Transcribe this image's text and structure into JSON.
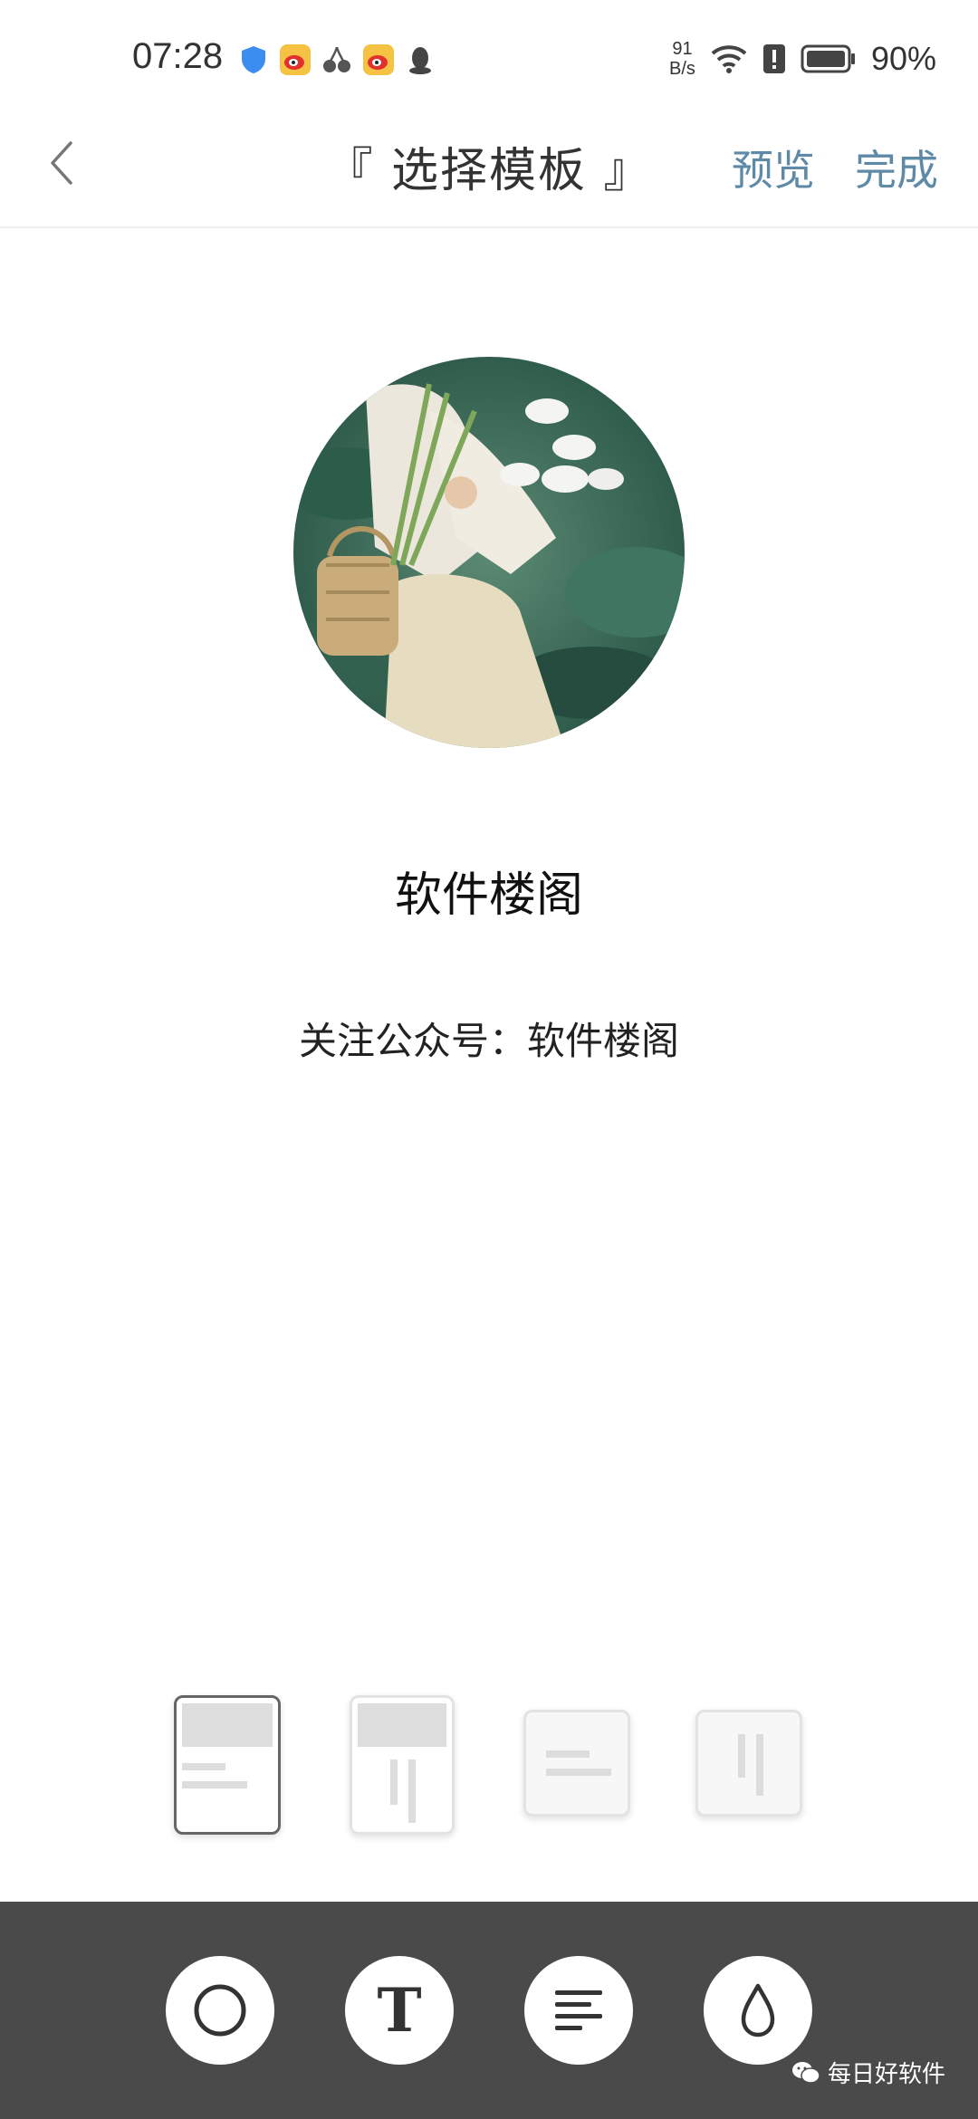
{
  "status_bar": {
    "time": "07:28",
    "net_speed_value": "91",
    "net_speed_unit": "B/s",
    "battery": "90%",
    "icons": [
      "shield-icon",
      "weibo-icon",
      "cherry-icon",
      "weibo-icon",
      "qq-icon",
      "wifi-icon",
      "alert-icon",
      "battery-icon"
    ]
  },
  "header": {
    "title": "『 选择模板 』",
    "preview_label": "预览",
    "done_label": "完成",
    "back_icon": "chevron-left-icon",
    "accent_color": "#5e8aa8"
  },
  "profile": {
    "name": "软件楼阁",
    "subtitle": "关注公众号：软件楼阁"
  },
  "templates": {
    "selected_index": 0,
    "count": 4
  },
  "toolbar": {
    "text_glyph": "T",
    "icons": [
      "circle-shape-icon",
      "text-style-icon",
      "align-left-icon",
      "color-drop-icon"
    ],
    "background_color": "#4a4a4a"
  },
  "watermark": {
    "text": "每日好软件"
  }
}
